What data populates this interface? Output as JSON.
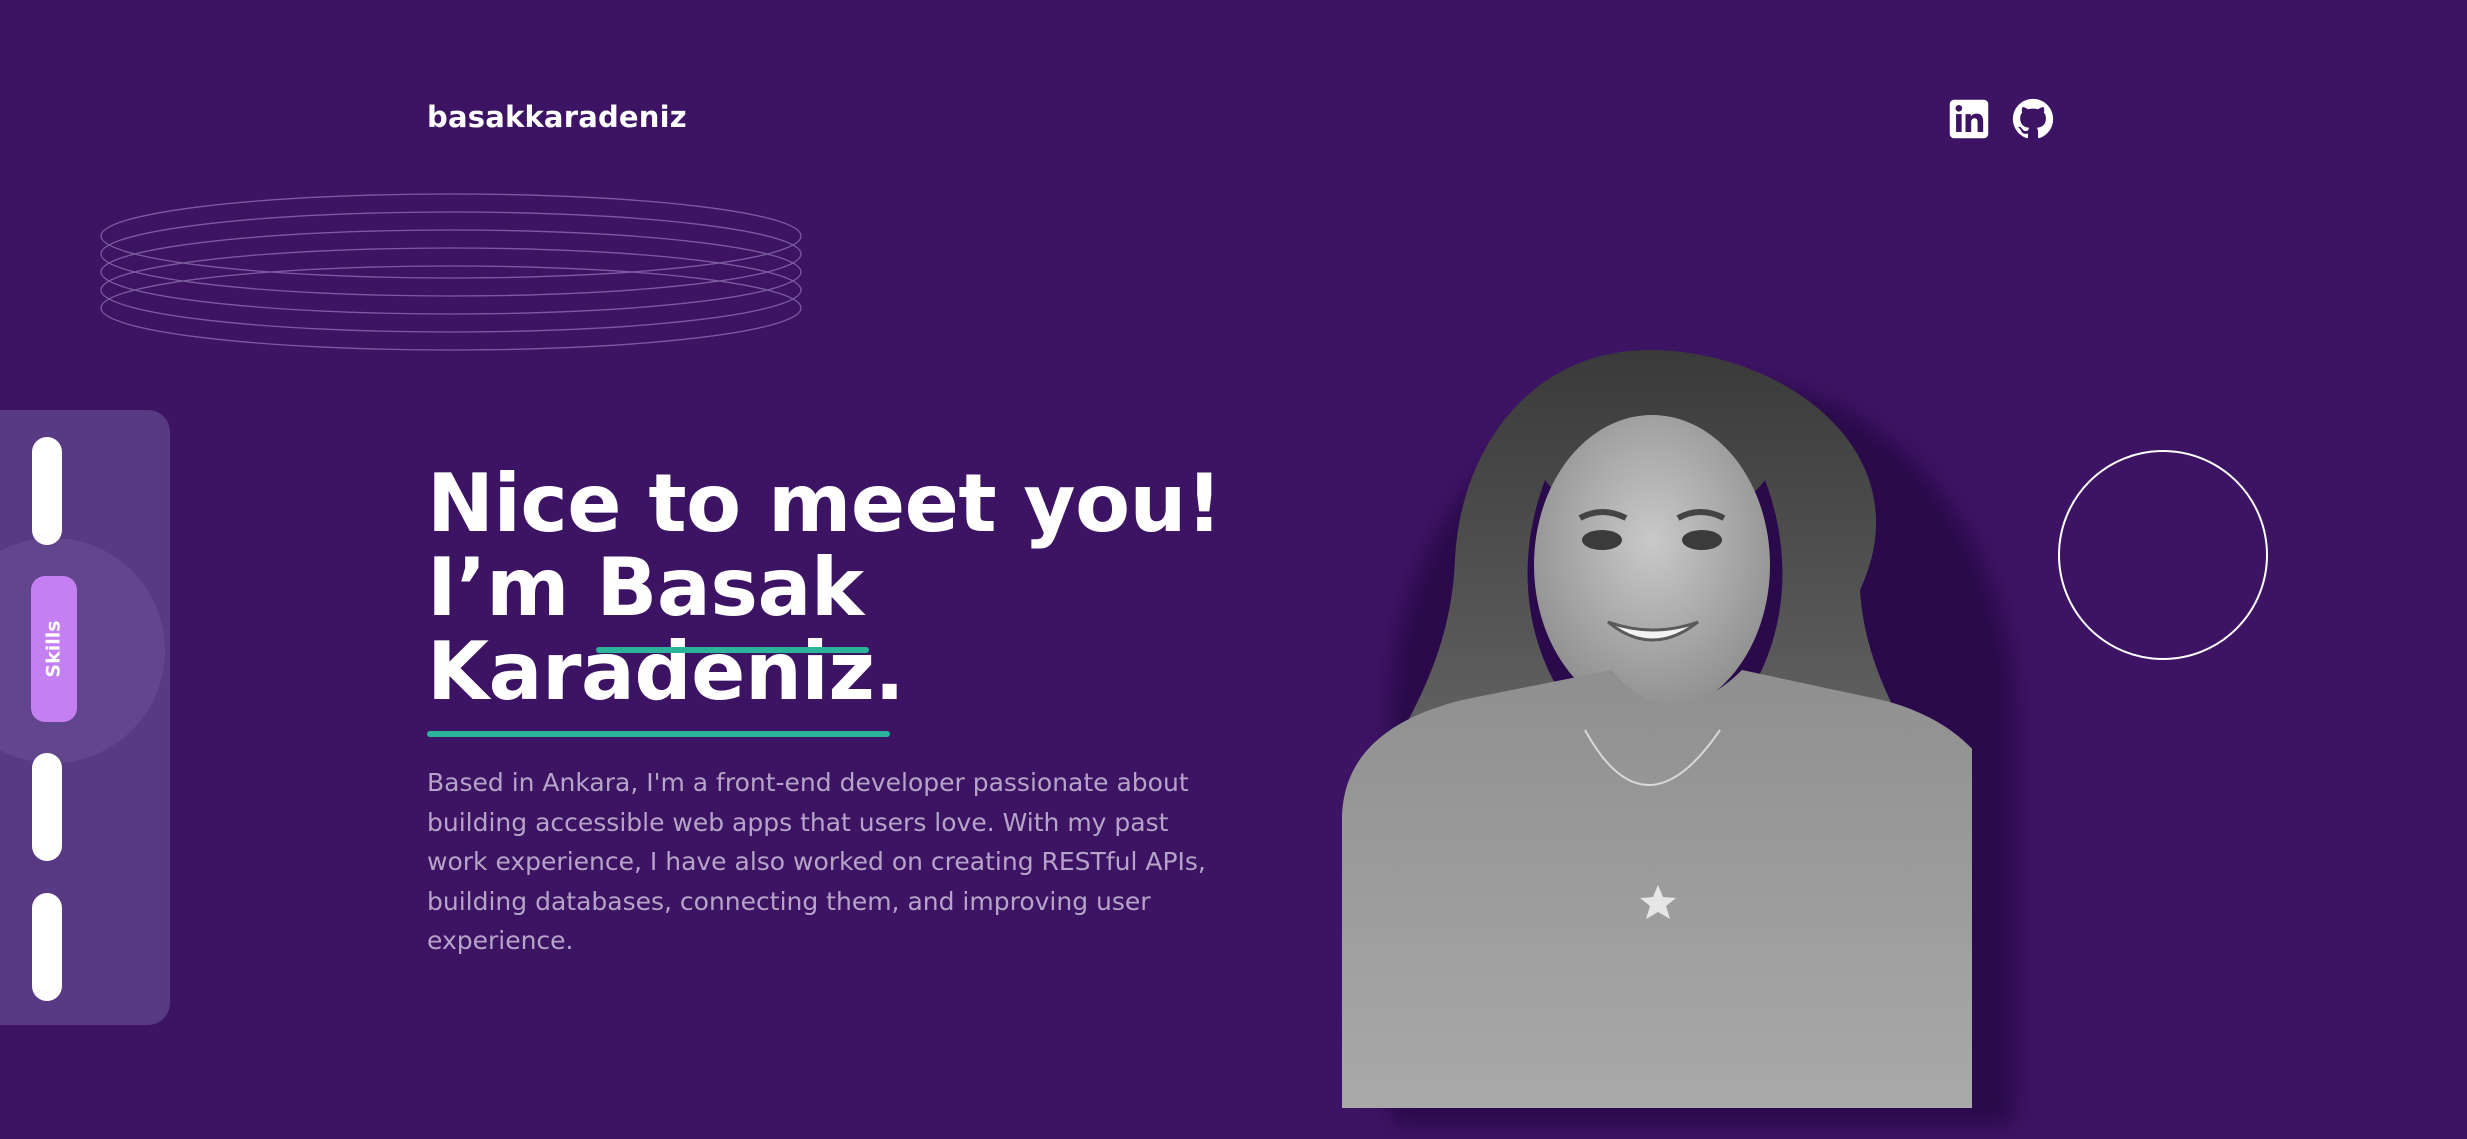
{
  "header": {
    "brand": "basakkaradeniz",
    "social": [
      {
        "name": "linkedin",
        "icon": "linkedin-icon"
      },
      {
        "name": "github",
        "icon": "github-icon"
      }
    ]
  },
  "sidebar": {
    "items": [
      {
        "label": ""
      },
      {
        "label": "Skills",
        "active": true
      },
      {
        "label": ""
      },
      {
        "label": ""
      }
    ]
  },
  "hero": {
    "headline_line1": "Nice to meet you!",
    "headline_line2": "I’m Basak",
    "headline_line3": "Karadeniz.",
    "intro": "Based in Ankara, I'm a front-end developer passionate about building accessible web apps that users love. With my past work experience, I have also worked on creating RESTful APIs, building databases, connecting them, and improving user experience."
  },
  "colors": {
    "background": "#3d1363",
    "accent_underline": "#2ab59a",
    "active_tab": "#c47ff1",
    "sidebar": "#583a84",
    "body_text": "#b5a4c8"
  }
}
